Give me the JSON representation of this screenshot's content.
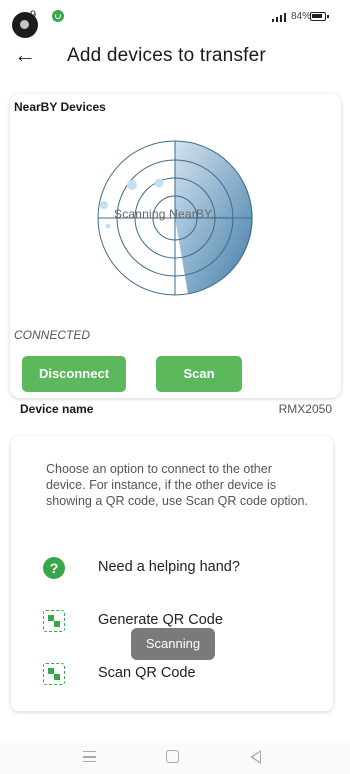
{
  "status_bar": {
    "time": "9",
    "battery": "84%",
    "icons": [
      "camera-icon",
      "app-status-icon",
      "signal-icon",
      "battery-icon"
    ]
  },
  "header": {
    "back_icon": "arrow-left-icon",
    "title": "Add devices to transfer"
  },
  "nearby": {
    "title": "NearBY Devices",
    "radar_label": "Scanning NearBY.....",
    "status": "CONNECTED",
    "disconnect_label": "Disconnect",
    "scan_label": "Scan"
  },
  "device": {
    "label": "Device name",
    "value": "RMX2050"
  },
  "options": {
    "instructions": "Choose an option to connect to the other device. For instance, if the other device is showing a QR code, use Scan QR code option.",
    "items": [
      {
        "label": "Need a helping hand?",
        "icon": "help-icon"
      },
      {
        "label": "Generate QR Code",
        "icon": "qr-code-icon"
      },
      {
        "label": "Scan QR Code",
        "icon": "qr-code-icon"
      }
    ]
  },
  "toast": {
    "text": "Scanning"
  },
  "colors": {
    "accent_green": "#5cb85c",
    "radar_blue": "#2e6f9e",
    "toast_gray": "#757575"
  },
  "nav": {
    "icons": [
      "menu-icon",
      "home-icon",
      "back-icon"
    ]
  }
}
